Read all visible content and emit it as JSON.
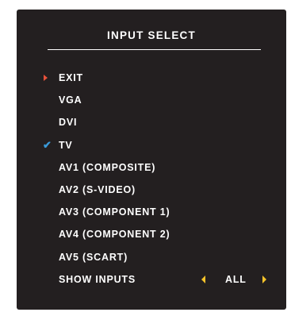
{
  "osd": {
    "title": "INPUT SELECT",
    "items": [
      {
        "label": "EXIT",
        "marker": "arrow-right-icon"
      },
      {
        "label": "VGA"
      },
      {
        "label": "DVI"
      },
      {
        "label": "TV",
        "marker": "checkmark-icon",
        "selected": true
      },
      {
        "label": "AV1 (COMPOSITE)"
      },
      {
        "label": "AV2 (S-VIDEO)"
      },
      {
        "label": "AV3 (COMPONENT 1)"
      },
      {
        "label": "AV4 (COMPONENT 2)"
      },
      {
        "label": "AV5 (SCART)"
      },
      {
        "label": "SHOW INPUTS"
      }
    ],
    "show_inputs": {
      "value": "ALL"
    },
    "check_glyph": "✔"
  },
  "colors": {
    "background": "#231f20",
    "text": "#ffffff",
    "cursor_arrow": "#e8513b",
    "checkmark": "#3a9ad9",
    "selector_arrows": "#f6c32a"
  }
}
